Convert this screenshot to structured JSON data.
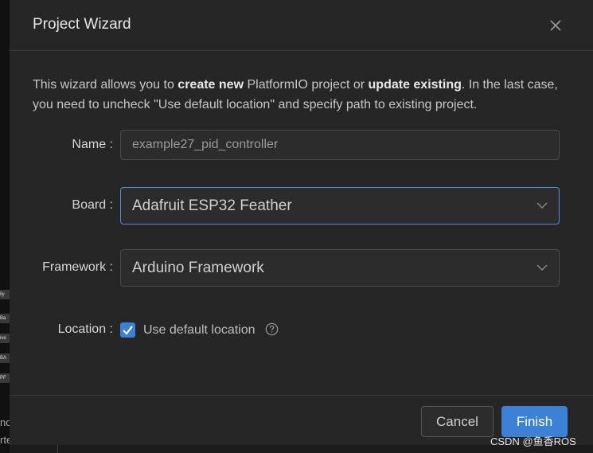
{
  "dialog": {
    "title": "Project Wizard",
    "intro": {
      "part1": "This wizard allows you to ",
      "bold1": "create new",
      "part2": " PlatformIO project or ",
      "bold2": "update existing",
      "part3": ". In the last case, you need to uncheck \"Use default location\" and specify path to existing project."
    },
    "fields": {
      "name_label": "Name :",
      "name_value": "example27_pid_controller",
      "board_label": "Board :",
      "board_value": "Adafruit ESP32 Feather",
      "framework_label": "Framework :",
      "framework_value": "Arduino Framework",
      "location_label": "Location :",
      "location_checkbox_label": "Use default location",
      "location_checked": true
    },
    "buttons": {
      "cancel": "Cancel",
      "finish": "Finish"
    }
  },
  "background": {
    "bits": [
      "ily",
      "Ba",
      "ive",
      "BA",
      "PF"
    ],
    "texts": [
      "nd",
      "rte"
    ]
  },
  "watermark": "CSDN @鱼香ROS",
  "colors": {
    "accent": "#3b82d6",
    "dialog_bg": "#262626"
  }
}
